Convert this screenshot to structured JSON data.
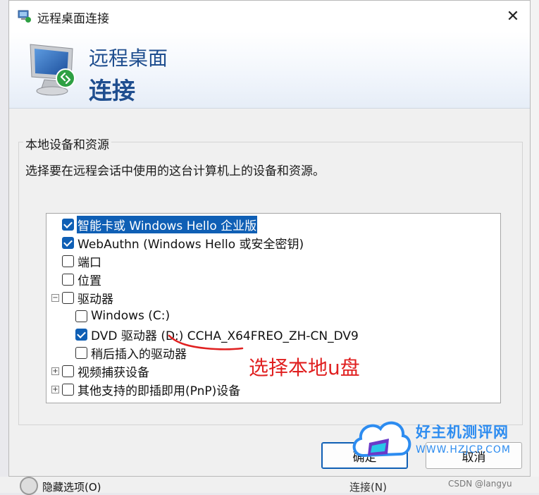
{
  "window": {
    "title": "远程桌面连接",
    "banner_line1": "远程桌面",
    "banner_line2": "连接",
    "close_glyph": "✕"
  },
  "group": {
    "title": "本地设备和资源",
    "description": "选择要在远程会话中使用的这台计算机上的设备和资源。"
  },
  "tree": {
    "items": [
      {
        "label": "智能卡或 Windows Hello 企业版",
        "checked": true,
        "selected": true
      },
      {
        "label": "WebAuthn (Windows Hello 或安全密钥)",
        "checked": true
      },
      {
        "label": "端口",
        "checked": false
      },
      {
        "label": "位置",
        "checked": false
      },
      {
        "label": "驱动器",
        "checked": false,
        "expander": "−"
      },
      {
        "label": "Windows  (C:)",
        "checked": false
      },
      {
        "label": "DVD 驱动器 (D:) CCHA_X64FREO_ZH-CN_DV9",
        "checked": true
      },
      {
        "label": "稍后插入的驱动器",
        "checked": false
      },
      {
        "label": "视频捕获设备",
        "checked": false,
        "expander": "+"
      },
      {
        "label": "其他支持的即插即用(PnP)设备",
        "checked": false,
        "expander": "+"
      }
    ]
  },
  "annotation": {
    "text": "选择本地u盘",
    "color": "#e02020"
  },
  "buttons": {
    "ok_label": "确定",
    "cancel_label": "取消"
  },
  "watermark": {
    "brand": "好主机测评网",
    "url": "WWW.HZJCP.COM"
  },
  "background": {
    "checkbox_label": "隐藏选项(O)",
    "mid_text": "连接(N)",
    "credit": "CSDN @langyu"
  },
  "colors": {
    "accent": "#0f5fb5",
    "banner_text": "#1f4e8f",
    "annotation": "#e02020",
    "watermark": "#2d8cf0"
  }
}
